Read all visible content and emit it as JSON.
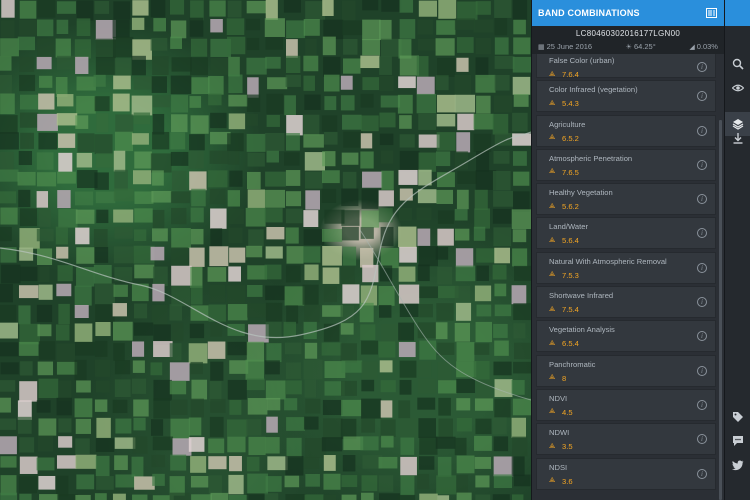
{
  "panel": {
    "title": "BAND COMBINATIONS",
    "scene_id": "LC80460302016177LGN00",
    "date": "25 June 2016",
    "sun_angle": "64.25°",
    "cloud_cover": "0.03%"
  },
  "band_combinations": [
    {
      "name": "False Color (urban)",
      "bands": "7.6.4"
    },
    {
      "name": "Color Infrared (vegetation)",
      "bands": "5.4.3"
    },
    {
      "name": "Agriculture",
      "bands": "6.5.2"
    },
    {
      "name": "Atmospheric Penetration",
      "bands": "7.6.5"
    },
    {
      "name": "Healthy Vegetation",
      "bands": "5.6.2"
    },
    {
      "name": "Land/Water",
      "bands": "5.6.4"
    },
    {
      "name": "Natural With Atmospheric Removal",
      "bands": "7.5.3"
    },
    {
      "name": "Shortwave Infrared",
      "bands": "7.5.4"
    },
    {
      "name": "Vegetation Analysis",
      "bands": "6.5.4"
    },
    {
      "name": "Panchromatic",
      "bands": "8"
    },
    {
      "name": "NDVI",
      "bands": "4.5"
    },
    {
      "name": "NDWI",
      "bands": "3.5"
    },
    {
      "name": "NDSI",
      "bands": "3.6"
    }
  ],
  "icons": {
    "close": "collapse-panel-icon",
    "search": "search-icon",
    "view": "eye-icon",
    "layers": "layers-icon",
    "download": "download-icon",
    "tag": "tag-icon",
    "comment": "comment-icon",
    "twitter": "twitter-icon",
    "info": "info-icon",
    "band": "band-icon"
  },
  "colors": {
    "accent": "#2a8fdc",
    "band_value": "#f4a623",
    "panel_bg": "#2b2f35"
  }
}
